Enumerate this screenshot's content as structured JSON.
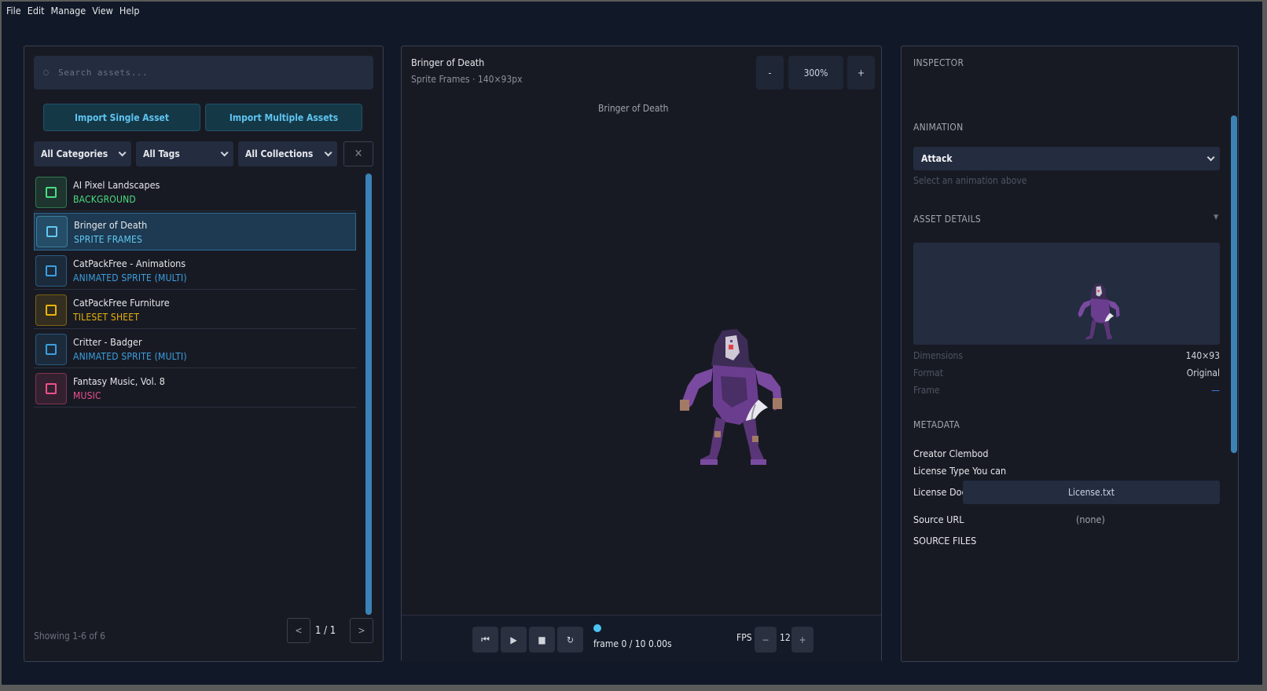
{
  "menu": [
    "File",
    "Edit",
    "Manage",
    "View",
    "Help"
  ],
  "library": {
    "search_placeholder": "Search assets...",
    "import_single": "Import Single Asset",
    "import_multiple": "Import Multiple Assets",
    "filters": {
      "category": "All Categories",
      "tags": "All Tags",
      "collections": "All Collections",
      "clear": "✕"
    },
    "assets": [
      {
        "name": "AI Pixel Landscapes",
        "type": "BACKGROUND",
        "color": "#4ade80",
        "icon": "image-icon"
      },
      {
        "name": "Bringer of Death",
        "type": "SPRITE FRAMES",
        "color": "#60c8f0",
        "icon": "sprite-frames-icon"
      },
      {
        "name": "CatPackFree - Animations",
        "type": "ANIMATED SPRITE (MULTI)",
        "color": "#3b9fe0",
        "icon": "animated-sprite-icon"
      },
      {
        "name": "CatPackFree Furniture",
        "type": "TILESET SHEET",
        "color": "#eab308",
        "icon": "tileset-icon"
      },
      {
        "name": "Critter - Badger",
        "type": "ANIMATED SPRITE (MULTI)",
        "color": "#3b9fe0",
        "icon": "animated-sprite-icon"
      },
      {
        "name": "Fantasy Music, Vol. 8",
        "type": "MUSIC",
        "color": "#f0508a",
        "icon": "music-icon"
      }
    ],
    "showing": "Showing 1-6 of 6",
    "page": "1 / 1",
    "prev": "<",
    "next": ">"
  },
  "viewer": {
    "title": "Bringer of Death",
    "subtitle": "Sprite Frames · 140×93px",
    "zoom_out": "-",
    "zoom": "300%",
    "zoom_in": "+",
    "canvas_label": "Bringer of Death",
    "controls": {
      "first": "⏮",
      "play": "▶",
      "stop": "■",
      "loop": "↻"
    },
    "frame_text": "frame 0 / 10  0.00s",
    "fps_label": "FPS",
    "fps_minus": "−",
    "fps_value": "12",
    "fps_plus": "+"
  },
  "inspector": {
    "title": "INSPECTOR",
    "animation_header": "ANIMATION",
    "animation_value": "Attack",
    "animation_hint": "Select an animation above",
    "details_header": "ASSET DETAILS",
    "collapse": "▼",
    "details": [
      {
        "key": "Dimensions",
        "value": "140×93",
        "value_color": "#d1d5db"
      },
      {
        "key": "Format",
        "value": "Original",
        "value_color": "#d1d5db"
      },
      {
        "key": "Frame",
        "value": "—",
        "value_color": "#3b82f6"
      }
    ],
    "metadata_header": "METADATA",
    "creator": "Creator Clembod",
    "license_type": "License Type You can",
    "license_doc_label": "License Doc",
    "license_doc_button": "License.txt",
    "source_url_label": "Source URL",
    "source_url_value": "(none)",
    "source_files": "SOURCE FILES"
  }
}
